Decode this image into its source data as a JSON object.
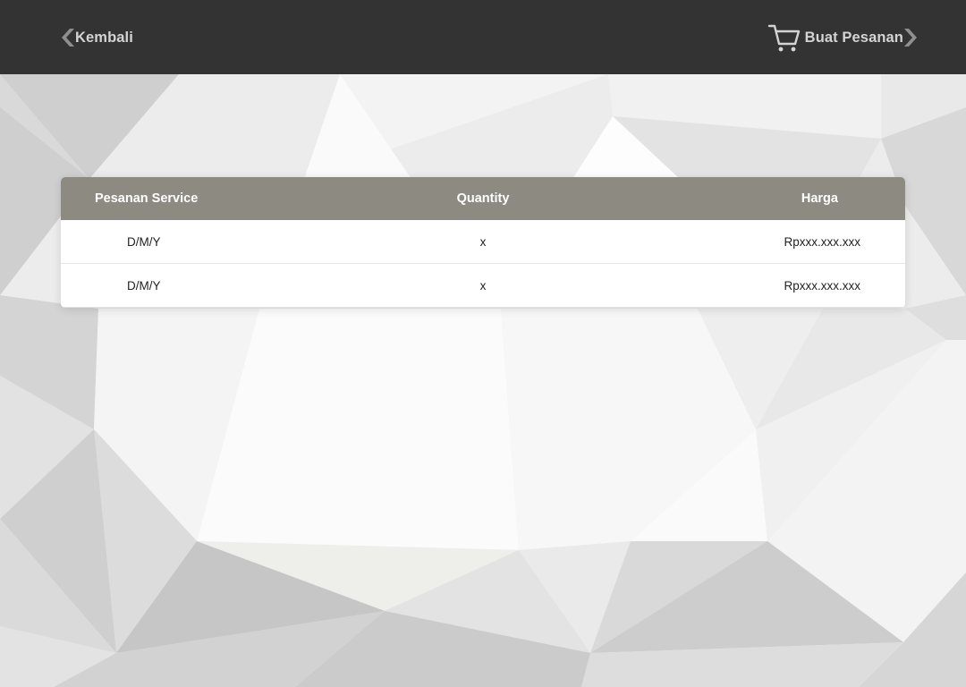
{
  "nav": {
    "back_label": "Kembali",
    "order_label": "Buat Pesanan",
    "back_icon": "chevron-left-icon",
    "cart_icon": "cart-icon",
    "forward_icon": "chevron-right-icon"
  },
  "table": {
    "headers": [
      "Pesanan Service",
      "Quantity",
      "Harga"
    ],
    "rows": [
      [
        "D/M/Y",
        "x",
        "Rpxxx.xxx.xxx"
      ],
      [
        "D/M/Y",
        "x",
        "Rpxxx.xxx.xxx"
      ]
    ]
  },
  "colors": {
    "topbar": "#333333",
    "header": "#8d8a82",
    "nav_text": "#d4d4d4"
  }
}
